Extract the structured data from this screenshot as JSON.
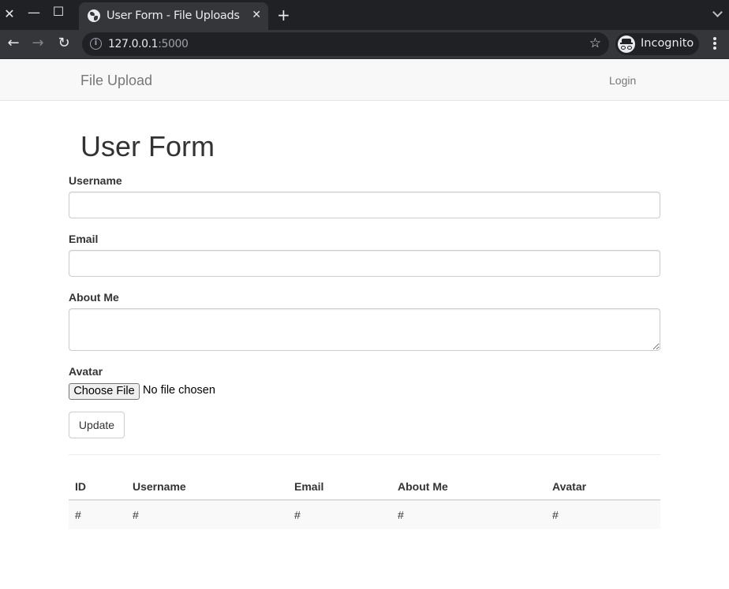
{
  "browser": {
    "window_controls": {
      "close": "✕",
      "minimize": "—",
      "maximize": "☐"
    },
    "tab": {
      "title": "User Form - File Uploads",
      "close": "✕"
    },
    "new_tab": "+",
    "nav": {
      "back": "←",
      "forward": "→",
      "reload": "↻"
    },
    "url": {
      "host": "127.0.0.1",
      "port": ":5000"
    },
    "info": "i",
    "star": "☆",
    "incognito_label": "Incognito"
  },
  "navbar": {
    "brand": "File Upload",
    "login": "Login"
  },
  "form": {
    "heading": "User Form",
    "fields": {
      "username": {
        "label": "Username",
        "value": ""
      },
      "email": {
        "label": "Email",
        "value": ""
      },
      "about": {
        "label": "About Me",
        "value": ""
      },
      "avatar": {
        "label": "Avatar",
        "button": "Choose File",
        "status": "No file chosen"
      }
    },
    "submit": "Update"
  },
  "table": {
    "headers": [
      "ID",
      "Username",
      "Email",
      "About Me",
      "Avatar"
    ],
    "rows": [
      [
        "#",
        "#",
        "#",
        "#",
        "#"
      ]
    ]
  }
}
